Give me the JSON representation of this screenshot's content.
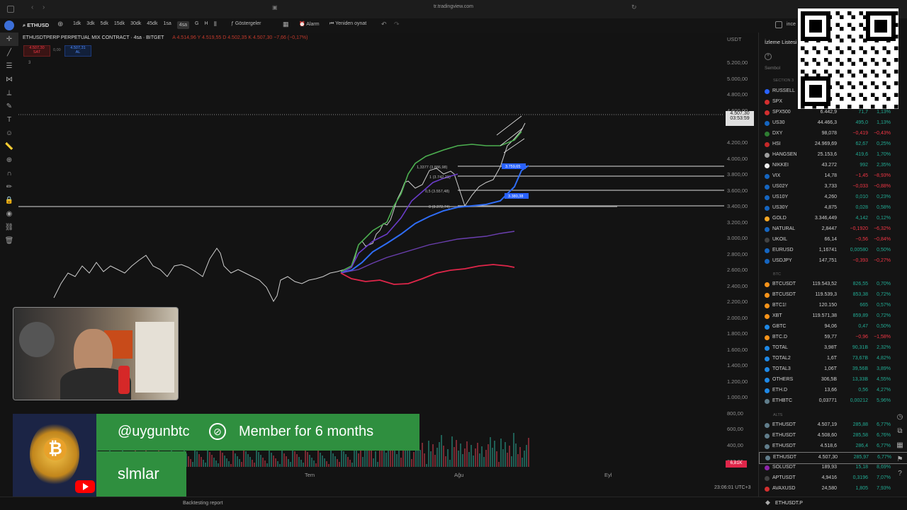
{
  "browser": {
    "url": "tr.tradingview.com"
  },
  "toolbar": {
    "symbol": "ETHUSD",
    "intervals": [
      "1dk",
      "3dk",
      "5dk",
      "15dk",
      "30dk",
      "45dk",
      "1sa",
      "4sa",
      "G",
      "H"
    ],
    "active_interval": "4sa",
    "indicators_label": "Göstergeler",
    "alarm_label": "Alarm",
    "replay_label": "Yeniden oynat",
    "right_label": "ince"
  },
  "legend": {
    "title": "ETHUSDTPERP PERPETUAL MIX CONTRACT · 4sa · BITGET",
    "ohlc": "A 4.514,96  Y 4.519,55  D 4.502,35  K 4.507,30  −7,66 (−0,17%)",
    "sell_price": "4.507,30",
    "sell_label": "SAT",
    "spread": "0,00",
    "buy_price": "4.507,31",
    "buy_label": "AL",
    "extra": "3"
  },
  "price_axis": {
    "currency": "USDT",
    "labels": [
      "5.200,00",
      "5.000,00",
      "4.800,00",
      "4.600,00",
      "4.200,00",
      "4.000,00",
      "3.800,00",
      "3.600,00",
      "3.400,00",
      "3.200,00",
      "3.000,00",
      "2.800,00",
      "2.600,00",
      "2.400,00",
      "2.200,00",
      "2.000,00",
      "1.800,00",
      "1.600,00",
      "1.400,00",
      "1.200,00",
      "1.000,00",
      "800,00",
      "600,00",
      "400,00",
      "200,00"
    ],
    "current_price": "4.507,30",
    "countdown": "03:53:59",
    "volume_badge": "6,81K"
  },
  "time_axis": {
    "labels": [
      "Tem",
      "Ağu",
      "Eyl"
    ],
    "clock": "23:06:01 UTC+3"
  },
  "fib": {
    "levels": [
      "1,3377 (3.886,98)",
      "1 (3.742,21)",
      "0,5 (3.557,48)",
      "0 (3.372,74)"
    ],
    "tag1": "3.759,65",
    "tag2": "3.380,38"
  },
  "watchlist": {
    "title": "İzleme Listesi",
    "column": "Sembol",
    "sections": [
      "SECTION 3",
      "BTC",
      "ALTS"
    ],
    "rows": [
      {
        "sym": "RUSSELL",
        "last": "",
        "chg": "",
        "pct": "",
        "color": "#2962ff",
        "dir": "pos"
      },
      {
        "sym": "SPX",
        "last": "",
        "chg": "",
        "pct": "",
        "color": "#d32f2f",
        "dir": "pos"
      },
      {
        "sym": "SPX500",
        "last": "6.442,9",
        "chg": "71,7",
        "pct": "1,13%",
        "color": "#d32f2f",
        "dir": "pos"
      },
      {
        "sym": "US30",
        "last": "44.466,3",
        "chg": "495,0",
        "pct": "1,13%",
        "color": "#1565c0",
        "dir": "pos"
      },
      {
        "sym": "DXY",
        "last": "98,078",
        "chg": "−0,419",
        "pct": "−0,43%",
        "color": "#2e7d32",
        "dir": "neg"
      },
      {
        "sym": "HSI",
        "last": "24.969,69",
        "chg": "62,67",
        "pct": "0,25%",
        "color": "#c62828",
        "dir": "pos"
      },
      {
        "sym": "HANGSEN",
        "last": "25.153,6",
        "chg": "419,6",
        "pct": "1,70%",
        "color": "#9e9e9e",
        "dir": "pos"
      },
      {
        "sym": "NIKKEI",
        "last": "43.272",
        "chg": "992",
        "pct": "2,35%",
        "color": "#eeeeee",
        "dir": "pos"
      },
      {
        "sym": "VIX",
        "last": "14,78",
        "chg": "−1,45",
        "pct": "−8,93%",
        "color": "#1565c0",
        "dir": "neg"
      },
      {
        "sym": "US02Y",
        "last": "3,733",
        "chg": "−0,033",
        "pct": "−0,88%",
        "color": "#1565c0",
        "dir": "neg"
      },
      {
        "sym": "US10Y",
        "last": "4,260",
        "chg": "0,010",
        "pct": "0,23%",
        "color": "#1565c0",
        "dir": "pos"
      },
      {
        "sym": "US30Y",
        "last": "4,875",
        "chg": "0,028",
        "pct": "0,58%",
        "color": "#1565c0",
        "dir": "pos"
      },
      {
        "sym": "GOLD",
        "last": "3.346,449",
        "chg": "4,142",
        "pct": "0,12%",
        "color": "#f9a825",
        "dir": "pos"
      },
      {
        "sym": "NATURAL",
        "last": "2,8447",
        "chg": "−0,1920",
        "pct": "−6,32%",
        "color": "#1565c0",
        "dir": "neg"
      },
      {
        "sym": "UKOIL",
        "last": "66,14",
        "chg": "−0,56",
        "pct": "−0,84%",
        "color": "#424242",
        "dir": "neg"
      },
      {
        "sym": "EURUSD",
        "last": "1,16741",
        "chg": "0,00580",
        "pct": "0,50%",
        "color": "#1565c0",
        "dir": "pos"
      },
      {
        "sym": "USDJPY",
        "last": "147,751",
        "chg": "−0,393",
        "pct": "−0,27%",
        "color": "#1565c0",
        "dir": "neg"
      },
      {
        "sym": "BTCUSDT",
        "last": "119.543,52",
        "chg": "826,55",
        "pct": "0,70%",
        "color": "#f7931a",
        "dir": "pos"
      },
      {
        "sym": "BTCUSDT",
        "last": "119.539,3",
        "chg": "853,38",
        "pct": "0,72%",
        "color": "#f7931a",
        "dir": "pos"
      },
      {
        "sym": "BTC1!",
        "last": "120.150",
        "chg": "665",
        "pct": "0,57%",
        "color": "#f7931a",
        "dir": "pos"
      },
      {
        "sym": "XBT",
        "last": "119.571,38",
        "chg": "859,89",
        "pct": "0,72%",
        "color": "#f7931a",
        "dir": "pos"
      },
      {
        "sym": "GBTC",
        "last": "94,06",
        "chg": "0,47",
        "pct": "0,50%",
        "color": "#1e88e5",
        "dir": "pos"
      },
      {
        "sym": "BTC.D",
        "last": "59,77",
        "chg": "−0,96",
        "pct": "−1,58%",
        "color": "#f7931a",
        "dir": "neg"
      },
      {
        "sym": "TOTAL",
        "last": "3,98T",
        "chg": "90,31B",
        "pct": "2,32%",
        "color": "#1e88e5",
        "dir": "pos"
      },
      {
        "sym": "TOTAL2",
        "last": "1,6T",
        "chg": "73,67B",
        "pct": "4,82%",
        "color": "#1e88e5",
        "dir": "pos"
      },
      {
        "sym": "TOTAL3",
        "last": "1,06T",
        "chg": "39,56B",
        "pct": "3,89%",
        "color": "#1e88e5",
        "dir": "pos"
      },
      {
        "sym": "OTHERS",
        "last": "306,5B",
        "chg": "13,33B",
        "pct": "4,55%",
        "color": "#1e88e5",
        "dir": "pos"
      },
      {
        "sym": "ETH.D",
        "last": "13,66",
        "chg": "0,56",
        "pct": "4,27%",
        "color": "#1e88e5",
        "dir": "pos"
      },
      {
        "sym": "ETHBTC",
        "last": "0,03771",
        "chg": "0,00212",
        "pct": "5,96%",
        "color": "#607d8b",
        "dir": "pos"
      },
      {
        "sym": "ETHUSDT",
        "last": "4.507,19",
        "chg": "285,88",
        "pct": "6,77%",
        "color": "#607d8b",
        "dir": "pos"
      },
      {
        "sym": "ETHUSDT",
        "last": "4.508,60",
        "chg": "285,58",
        "pct": "6,76%",
        "color": "#607d8b",
        "dir": "pos"
      },
      {
        "sym": "ETHUSDT",
        "last": "4.518,6",
        "chg": "286,4",
        "pct": "6,77%",
        "color": "#607d8b",
        "dir": "pos"
      },
      {
        "sym": "ETHUSDT",
        "last": "4.507,30",
        "chg": "285,97",
        "pct": "6,77%",
        "color": "#607d8b",
        "dir": "pos"
      },
      {
        "sym": "SOLUSDT",
        "last": "189,93",
        "chg": "15,18",
        "pct": "8,69%",
        "color": "#8e24aa",
        "dir": "pos"
      },
      {
        "sym": "APTUSDT",
        "last": "4,9416",
        "chg": "0,3196",
        "pct": "7,07%",
        "color": "#424242",
        "dir": "pos"
      },
      {
        "sym": "AVAXUSD",
        "last": "24,580",
        "chg": "1,805",
        "pct": "7,93%",
        "color": "#d32f2f",
        "dir": "pos"
      }
    ],
    "footer_symbol": "ETHUSDT.P"
  },
  "bottom": {
    "backtest_label": "Backtesting report"
  },
  "chat": {
    "username": "@uygunbtc",
    "member_text": "Member for 6 months",
    "message": "slmlar"
  }
}
